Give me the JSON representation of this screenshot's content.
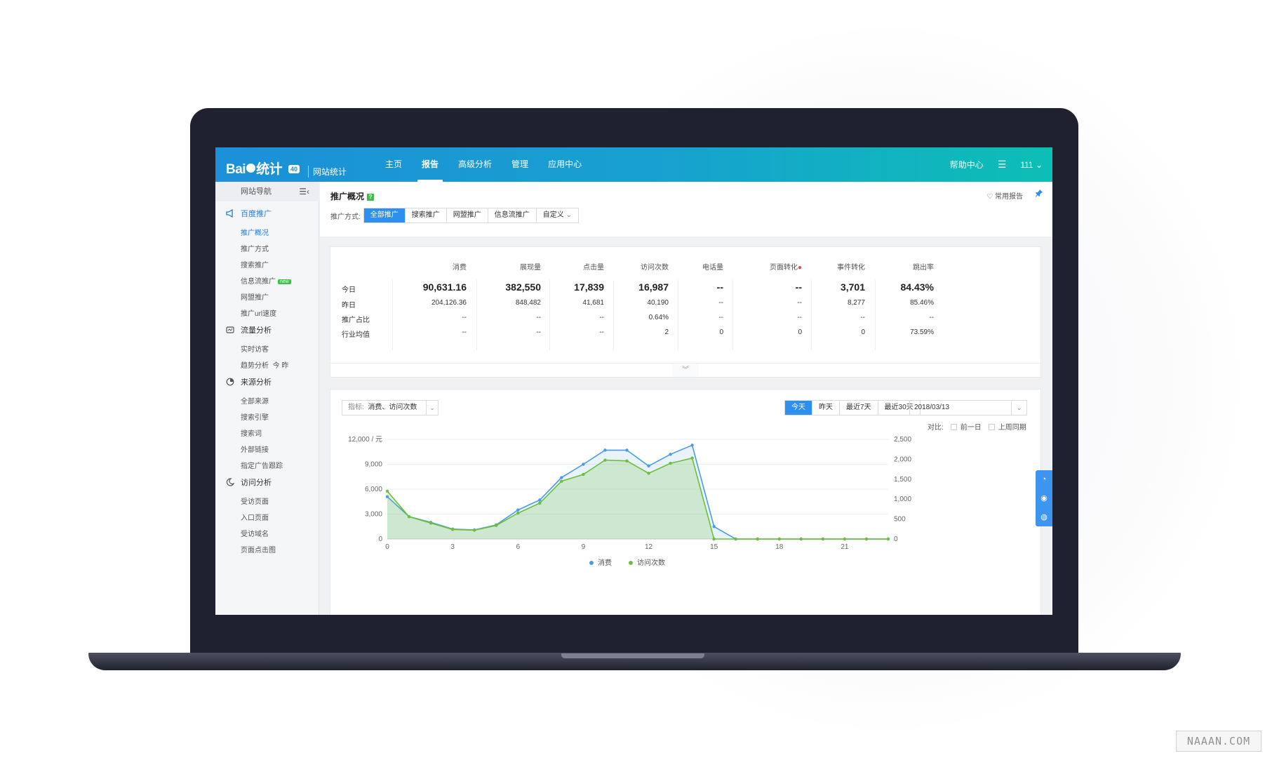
{
  "brand": {
    "logo_text": "Bai",
    "logo_text2": "统计",
    "version": "40",
    "subtitle": "网站统计"
  },
  "nav": {
    "items": [
      "主页",
      "报告",
      "高级分析",
      "管理",
      "应用中心"
    ],
    "active": 1
  },
  "nav_right": {
    "help": "帮助中心",
    "user": "111"
  },
  "sidebar": {
    "header": "网站导航",
    "groups": [
      {
        "label": "百度推广",
        "icon": "megaphone-icon",
        "active": true,
        "items": [
          {
            "label": "推广概况",
            "active": true
          },
          {
            "label": "推广方式"
          },
          {
            "label": "搜索推广"
          },
          {
            "label": "信息流推广",
            "badge": "new"
          },
          {
            "label": "网盟推广"
          },
          {
            "label": "推广url速度"
          }
        ]
      },
      {
        "label": "流量分析",
        "icon": "traffic-icon",
        "items": [
          {
            "label": "实时访客"
          },
          {
            "label": "趋势分析",
            "extra": "今  昨"
          }
        ]
      },
      {
        "label": "来源分析",
        "icon": "pie-icon",
        "items": [
          {
            "label": "全部来源"
          },
          {
            "label": "搜索引擎"
          },
          {
            "label": "搜索词"
          },
          {
            "label": "外部链接"
          },
          {
            "label": "指定广告跟踪"
          }
        ]
      },
      {
        "label": "访问分析",
        "icon": "moon-icon",
        "items": [
          {
            "label": "受访页面"
          },
          {
            "label": "入口页面"
          },
          {
            "label": "受访域名"
          },
          {
            "label": "页面点击图"
          }
        ]
      }
    ]
  },
  "page": {
    "title": "推广概况",
    "help": "?",
    "fav_label": "常用报告",
    "method_label": "推广方式:",
    "methods": [
      "全部推广",
      "搜索推广",
      "网盟推广",
      "信息流推广",
      "自定义"
    ]
  },
  "summary": {
    "columns": [
      "消费",
      "展现量",
      "点击量",
      "访问次数",
      "电话量",
      "页面转化",
      "事件转化",
      "跳出率"
    ],
    "rows": [
      {
        "label": "今日",
        "values": [
          "90,631.16",
          "382,550",
          "17,839",
          "16,987",
          "--",
          "--",
          "3,701",
          "84.43%"
        ]
      },
      {
        "label": "昨日",
        "values": [
          "204,126.36",
          "848,482",
          "41,681",
          "40,190",
          "--",
          "--",
          "8,277",
          "85.46%"
        ]
      },
      {
        "label": "推广占比",
        "values": [
          "--",
          "--",
          "--",
          "0.64%",
          "--",
          "--",
          "--",
          "--"
        ]
      },
      {
        "label": "行业均值",
        "values": [
          "--",
          "--",
          "--",
          "2",
          "0",
          "0",
          "0",
          "73.59%"
        ]
      }
    ]
  },
  "chart_controls": {
    "metric_label": "指标:",
    "metric_value": "消费、访问次数",
    "ranges": [
      "今天",
      "昨天",
      "最近7天",
      "最近30天"
    ],
    "active_range": 0,
    "date": "2018/03/13",
    "compare_label": "对比:",
    "compare_options": [
      "前一日",
      "上周同期"
    ]
  },
  "chart_data": {
    "type": "line",
    "x": [
      0,
      1,
      2,
      3,
      4,
      5,
      6,
      7,
      8,
      9,
      10,
      11,
      12,
      13,
      14,
      15,
      16,
      17,
      18,
      19,
      20,
      21,
      22,
      23
    ],
    "xticks": [
      "0",
      "3",
      "6",
      "9",
      "12",
      "15",
      "18",
      "21"
    ],
    "ylabel_left": "12,000 / 元",
    "yticks_left": [
      "12,000 / 元",
      "9,000",
      "6,000",
      "3,000",
      "0"
    ],
    "yticks_right": [
      "2,500",
      "2,000",
      "1,500",
      "1,000",
      "500",
      "0"
    ],
    "ylim_left": [
      0,
      12000
    ],
    "ylim_right": [
      0,
      2500
    ],
    "series": [
      {
        "name": "消费",
        "axis": "left",
        "color": "#4a9be8",
        "values": [
          5100,
          2700,
          2000,
          1200,
          1100,
          1700,
          3500,
          4700,
          7400,
          9000,
          10700,
          10700,
          8800,
          10200,
          11300,
          1500,
          0,
          0,
          0,
          0,
          0,
          0,
          0,
          0
        ]
      },
      {
        "name": "访问次数",
        "axis": "right",
        "color": "#6cbf3a",
        "values": [
          1200,
          560,
          400,
          240,
          220,
          340,
          650,
          900,
          1450,
          1620,
          1980,
          1960,
          1650,
          1900,
          2030,
          0,
          0,
          0,
          0,
          0,
          0,
          0,
          0,
          0
        ]
      }
    ],
    "legend": "bottom-center"
  },
  "watermark": "NAAAN.COM"
}
